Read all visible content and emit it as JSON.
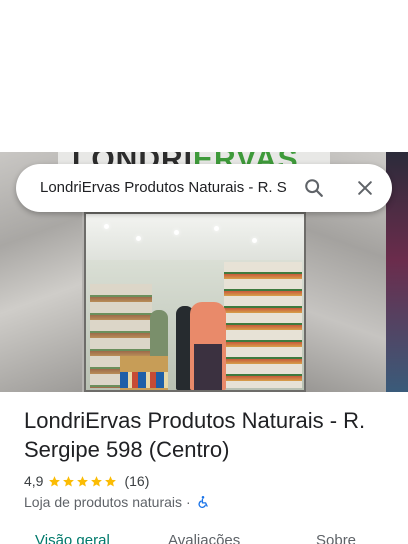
{
  "search": {
    "query": "LondriErvas Produtos Naturais - R. S",
    "search_icon": "search-icon",
    "close_icon": "close-icon"
  },
  "photo": {
    "sign_text_dark": "LONDRI",
    "sign_text_green": "ERVAS"
  },
  "place": {
    "title": "LondriErvas Produtos Naturais - R. Sergipe 598 (Centro)",
    "rating": "4,9",
    "reviews": "(16)",
    "category": "Loja de produtos naturais",
    "separator": "·",
    "accessibility_icon": "wheelchair-icon"
  },
  "tabs": [
    {
      "label": "Visão geral",
      "active": true
    },
    {
      "label": "Avaliações",
      "active": false
    },
    {
      "label": "Sobre",
      "active": false
    }
  ],
  "colors": {
    "star": "#fbbc04",
    "accent": "#1a73e8",
    "active_tab": "#00796b"
  }
}
